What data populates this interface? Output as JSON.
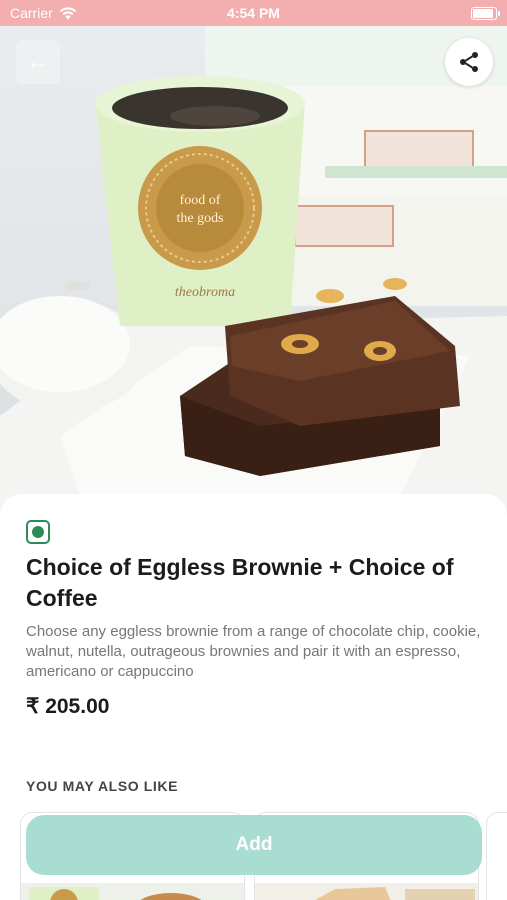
{
  "status_bar": {
    "carrier": "Carrier",
    "time": "4:54 PM",
    "battery_level": 1.0,
    "background_color": "#f3aeb0"
  },
  "hero": {
    "cup_text": "food of the gods",
    "brand_script": "theobroma",
    "back_icon": "arrow-left-icon",
    "share_icon": "share-icon"
  },
  "product": {
    "veg_indicator_color": "#2e8b57",
    "title": "Choice of Eggless Brownie + Choice of Coffee",
    "description": "Choose any eggless brownie from a range of chocolate chip, cookie, walnut, nutella, outrageous brownies and pair it with an espresso, americano or cappuccino",
    "price": "₹ 205.00"
  },
  "recommendations": {
    "heading": "YOU MAY ALSO LIKE"
  },
  "cta": {
    "add_label": "Add",
    "color": "#a9ddd1"
  }
}
